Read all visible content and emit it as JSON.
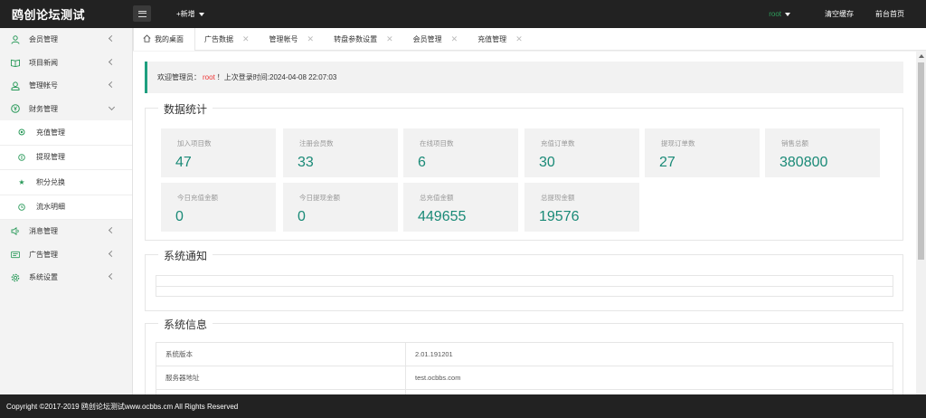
{
  "header": {
    "logo": "鸥创论坛测试",
    "add_new": "+新增",
    "user": "root",
    "clear_cache": "清空缓存",
    "front_home": "前台首页"
  },
  "sidebar": {
    "items": [
      {
        "label": "会员管理",
        "icon": "user-icon"
      },
      {
        "label": "项目新闻",
        "icon": "book-icon"
      },
      {
        "label": "管理帐号",
        "icon": "admin-icon"
      },
      {
        "label": "财务管理",
        "icon": "yen-icon",
        "expanded": true,
        "children": [
          {
            "label": "充值管理",
            "icon": "dot-icon"
          },
          {
            "label": "提现管理",
            "icon": "coin-icon"
          },
          {
            "label": "积分兑换",
            "icon": "star-icon"
          },
          {
            "label": "流水明细",
            "icon": "clock-icon"
          }
        ]
      },
      {
        "label": "消息管理",
        "icon": "speaker-icon"
      },
      {
        "label": "广告管理",
        "icon": "ad-icon"
      },
      {
        "label": "系统设置",
        "icon": "gear-icon"
      }
    ]
  },
  "tabs": [
    {
      "label": "我的桌面",
      "active": true
    },
    {
      "label": "广告数据"
    },
    {
      "label": "管理帐号"
    },
    {
      "label": "转盘参数设置"
    },
    {
      "label": "会员管理"
    },
    {
      "label": "充值管理"
    }
  ],
  "welcome": {
    "prefix": "欢迎管理员：",
    "user": "root",
    "suffix": "！上次登录时间:2024-04-08 22:07:03"
  },
  "stats": {
    "title": "数据统计",
    "cards": [
      {
        "label": "加入项目数",
        "value": "47"
      },
      {
        "label": "注册会员数",
        "value": "33"
      },
      {
        "label": "在线项目数",
        "value": "6"
      },
      {
        "label": "充值订单数",
        "value": "30"
      },
      {
        "label": "提现订单数",
        "value": "27"
      },
      {
        "label": "销售总额",
        "value": "380800"
      },
      {
        "label": "今日充值金额",
        "value": "0"
      },
      {
        "label": "今日提现金额",
        "value": "0"
      },
      {
        "label": "总充值金额",
        "value": "449655"
      },
      {
        "label": "总提现金额",
        "value": "19576"
      }
    ]
  },
  "notice": {
    "title": "系统通知"
  },
  "sysinfo": {
    "title": "系统信息",
    "rows": [
      {
        "key": "系统版本",
        "value": "2.01.191201"
      },
      {
        "key": "服务器地址",
        "value": "test.ocbbs.com"
      },
      {
        "key": "",
        "value": ""
      }
    ]
  },
  "footer": {
    "text": "Copyright ©2017-2019 鸥创论坛测试www.ocbbs.cm All Rights Reserved"
  },
  "colors": {
    "accent": "#1a8a77",
    "topbar": "#222222",
    "username_red": "#ee3333",
    "username_green": "#2e9e5b"
  }
}
